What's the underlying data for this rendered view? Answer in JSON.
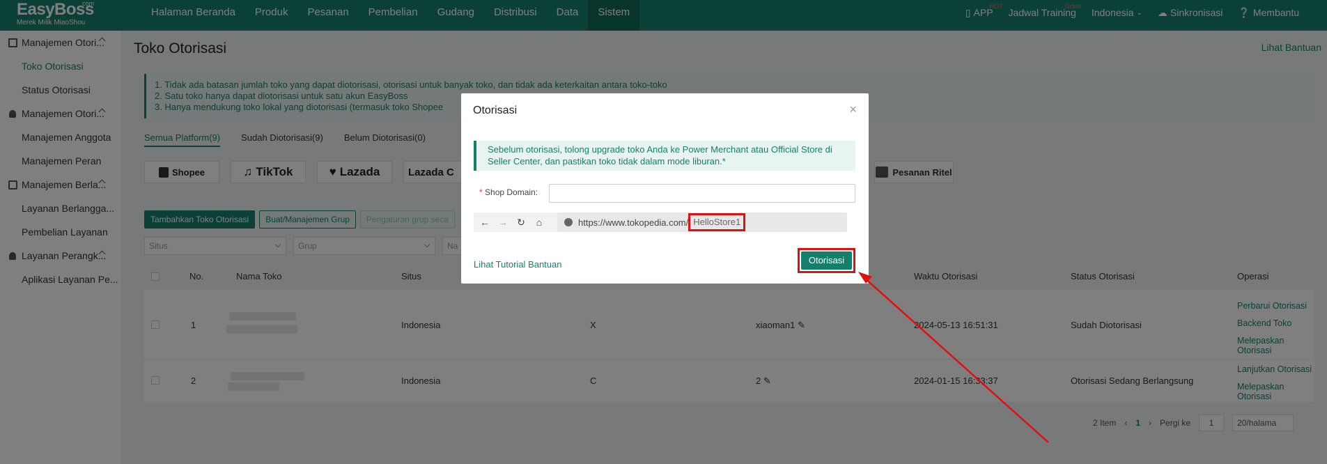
{
  "brand": {
    "name": "EasyBoss",
    "suffix": "com",
    "tagline": "Merek Milik MiaoShou"
  },
  "nav": [
    {
      "label": "Halaman Beranda",
      "active": false
    },
    {
      "label": "Produk",
      "active": false
    },
    {
      "label": "Pesanan",
      "active": false
    },
    {
      "label": "Pembelian",
      "active": false
    },
    {
      "label": "Gudang",
      "active": false
    },
    {
      "label": "Distribusi",
      "active": false
    },
    {
      "label": "Data",
      "active": false
    },
    {
      "label": "Sistem",
      "active": true
    }
  ],
  "topright": {
    "app": "APP",
    "app_badge": "HOT",
    "training": "Jadwal Training",
    "training_badge": "Gratis",
    "language": "Indonesia",
    "sync": "Sinkronisasi",
    "help": "Membantu"
  },
  "sidebar": {
    "groups": [
      {
        "label": "Manajemen Otori...",
        "items": [
          "Toko Otorisasi",
          "Status Otorisasi"
        ]
      },
      {
        "label": "Manajemen Otori...",
        "items": [
          "Manajemen Anggota",
          "Manajemen Peran"
        ]
      },
      {
        "label": "Manajemen Berla...",
        "items": [
          "Layanan Berlangga...",
          "Pembelian Layanan"
        ]
      },
      {
        "label": "Layanan Perangk...",
        "items": [
          "Aplikasi Layanan Pe..."
        ]
      }
    ],
    "active_item": "Toko Otorisasi"
  },
  "page": {
    "title": "Toko Otorisasi",
    "help_link": "Lihat Bantuan",
    "notice": [
      "1. Tidak ada batasan jumlah toko yang dapat diotorisasi, otorisasi untuk banyak toko, dan tidak ada keterkaitan antara toko-toko",
      "2. Satu toko hanya dapat diotorisasi untuk satu akun EasyBoss",
      "3. Hanya mendukung toko lokal yang diotorisasi (termasuk toko Shopee"
    ],
    "tabs": [
      "Semua Platform(9)",
      "Sudah Diotorisasi(9)",
      "Belum Diotorisasi(0)"
    ],
    "platforms": [
      "Shopee",
      "TikTok",
      "Lazada",
      "Lazada C"
    ],
    "retail_platform": "Pesanan Ritel",
    "actions": {
      "add": "Tambahkan Toko Otorisasi",
      "group": "Buat/Manajemen Grup",
      "group_setting": "Pengaturan grup seca"
    },
    "filters": {
      "site": "Situs",
      "group": "Grup",
      "third": "Na"
    },
    "table": {
      "headers": {
        "no": "No.",
        "name": "Nama Toko",
        "site": "Situs",
        "time": "Waktu Otorisasi",
        "status": "Status Otorisasi",
        "ops": "Operasi"
      },
      "rows": [
        {
          "no": "1",
          "site": "Indonesia",
          "col": "X",
          "account": "xiaoman1",
          "time": "2024-05-13 16:51:31",
          "status": "Sudah Diotorisasi",
          "ops": [
            "Perbarui Otorisasi",
            "Backend Toko",
            "Melepaskan Otorisasi"
          ]
        },
        {
          "no": "2",
          "site": "Indonesia",
          "col": "C",
          "account": "2",
          "time": "2024-01-15 16:33:37",
          "status": "Otorisasi Sedang Berlangsung",
          "ops": [
            "Lanjutkan Otorisasi",
            "Melepaskan Otorisasi"
          ]
        }
      ]
    },
    "pager": {
      "total": "2 Item",
      "current": "1",
      "goto_label": "Pergi ke",
      "goto_value": "1",
      "page_size": "20/halama"
    }
  },
  "modal": {
    "title": "Otorisasi",
    "notice": "Sebelum otorisasi, tolong upgrade toko Anda ke Power Merchant atau Official Store di Seller Center, dan pastikan toko tidak dalam mode liburan.*",
    "field_label": "Shop Domain:",
    "field_value": "",
    "url_prefix": "https://www.tokopedia.com/",
    "url_highlight": "HelloStore1",
    "tutorial_link": "Lihat Tutorial Bantuan",
    "submit": "Otorisasi"
  },
  "colors": {
    "brand": "#14806b",
    "highlight": "#e01010"
  }
}
